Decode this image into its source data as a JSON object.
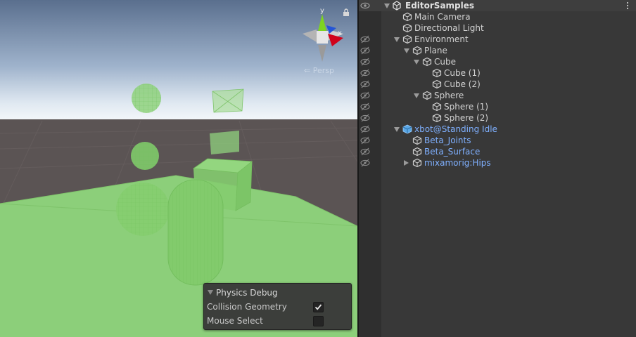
{
  "scene_view": {
    "projection_label": "Persp",
    "axis_labels": {
      "y": "y",
      "x": "x"
    },
    "physics_debug": {
      "title": "Physics Debug",
      "options": [
        {
          "label": "Collision Geometry",
          "checked": true
        },
        {
          "label": "Mouse Select",
          "checked": false
        }
      ]
    }
  },
  "hierarchy": {
    "scene_name": "EditorSamples",
    "items": [
      {
        "label": "Main Camera",
        "depth": 1,
        "expand": "none",
        "type": "gameobject",
        "eye": false
      },
      {
        "label": "Directional Light",
        "depth": 1,
        "expand": "none",
        "type": "gameobject",
        "eye": false
      },
      {
        "label": "Environment",
        "depth": 1,
        "expand": "open",
        "type": "gameobject",
        "eye": true
      },
      {
        "label": "Plane",
        "depth": 2,
        "expand": "open",
        "type": "gameobject",
        "eye": true
      },
      {
        "label": "Cube",
        "depth": 3,
        "expand": "open",
        "type": "gameobject",
        "eye": true
      },
      {
        "label": "Cube (1)",
        "depth": 4,
        "expand": "none",
        "type": "gameobject",
        "eye": true
      },
      {
        "label": "Cube (2)",
        "depth": 4,
        "expand": "none",
        "type": "gameobject",
        "eye": true
      },
      {
        "label": "Sphere",
        "depth": 3,
        "expand": "open",
        "type": "gameobject",
        "eye": true
      },
      {
        "label": "Sphere (1)",
        "depth": 4,
        "expand": "none",
        "type": "gameobject",
        "eye": true
      },
      {
        "label": "Sphere (2)",
        "depth": 4,
        "expand": "none",
        "type": "gameobject",
        "eye": true
      },
      {
        "label": "xbot@Standing Idle",
        "depth": 1,
        "expand": "open",
        "type": "prefab-root",
        "eye": true
      },
      {
        "label": "Beta_Joints",
        "depth": 2,
        "expand": "none",
        "type": "prefab",
        "eye": true
      },
      {
        "label": "Beta_Surface",
        "depth": 2,
        "expand": "none",
        "type": "prefab",
        "eye": true
      },
      {
        "label": "mixamorig:Hips",
        "depth": 2,
        "expand": "closed",
        "type": "prefab",
        "eye": true
      }
    ]
  },
  "colors": {
    "prefab_text": "#7fb0ff",
    "collider_green": "#8ed67a",
    "panel_bg": "#383838"
  }
}
